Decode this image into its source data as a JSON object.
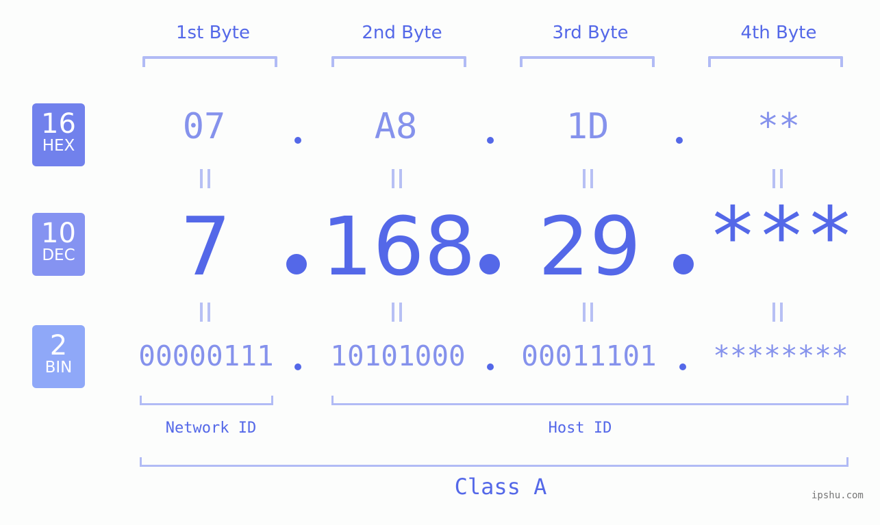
{
  "headers": [
    "1st Byte",
    "2nd Byte",
    "3rd Byte",
    "4th Byte"
  ],
  "badges": {
    "hex": {
      "num": "16",
      "label": "HEX",
      "color": "#7181ec"
    },
    "dec": {
      "num": "10",
      "label": "DEC",
      "color": "#8593f1"
    },
    "bin": {
      "num": "2",
      "label": "BIN",
      "color": "#8fa8f8"
    }
  },
  "hex": [
    "07",
    "A8",
    "1D",
    "**"
  ],
  "dec": [
    "7",
    "168",
    "29",
    "***"
  ],
  "bin": [
    "00000111",
    "10101000",
    "00011101",
    "********"
  ],
  "network_label": "Network ID",
  "host_label": "Host ID",
  "class_label": "Class A",
  "watermark": "ipshu.com",
  "colors": {
    "primary": "#5468e8",
    "secondary": "#8592ec",
    "bracket": "#b1bbf5",
    "background": "#fcfdfc"
  }
}
